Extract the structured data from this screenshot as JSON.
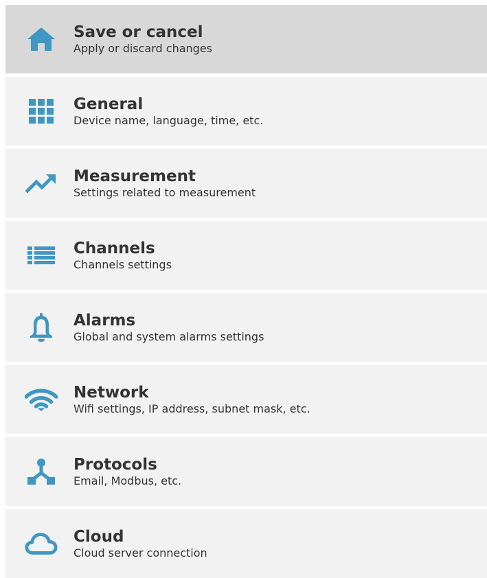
{
  "colors": {
    "icon": "#3f97c2",
    "text": "#333333",
    "item_bg": "#f2f2f2",
    "active_bg": "#d8d8d8"
  },
  "menu": {
    "items": [
      {
        "icon": "home-icon",
        "title": "Save or cancel",
        "subtitle": "Apply or discard changes",
        "active": true
      },
      {
        "icon": "grid-icon",
        "title": "General",
        "subtitle": "Device name, language, time, etc."
      },
      {
        "icon": "trend-up-icon",
        "title": "Measurement",
        "subtitle": "Settings related to measurement"
      },
      {
        "icon": "list-icon",
        "title": "Channels",
        "subtitle": "Channels settings"
      },
      {
        "icon": "bell-icon",
        "title": "Alarms",
        "subtitle": "Global and system alarms settings"
      },
      {
        "icon": "wifi-icon",
        "title": "Network",
        "subtitle": "Wifi settings, IP address, subnet mask, etc."
      },
      {
        "icon": "protocol-icon",
        "title": "Protocols",
        "subtitle": "Email, Modbus, etc."
      },
      {
        "icon": "cloud-icon",
        "title": "Cloud",
        "subtitle": "Cloud server connection"
      }
    ]
  }
}
